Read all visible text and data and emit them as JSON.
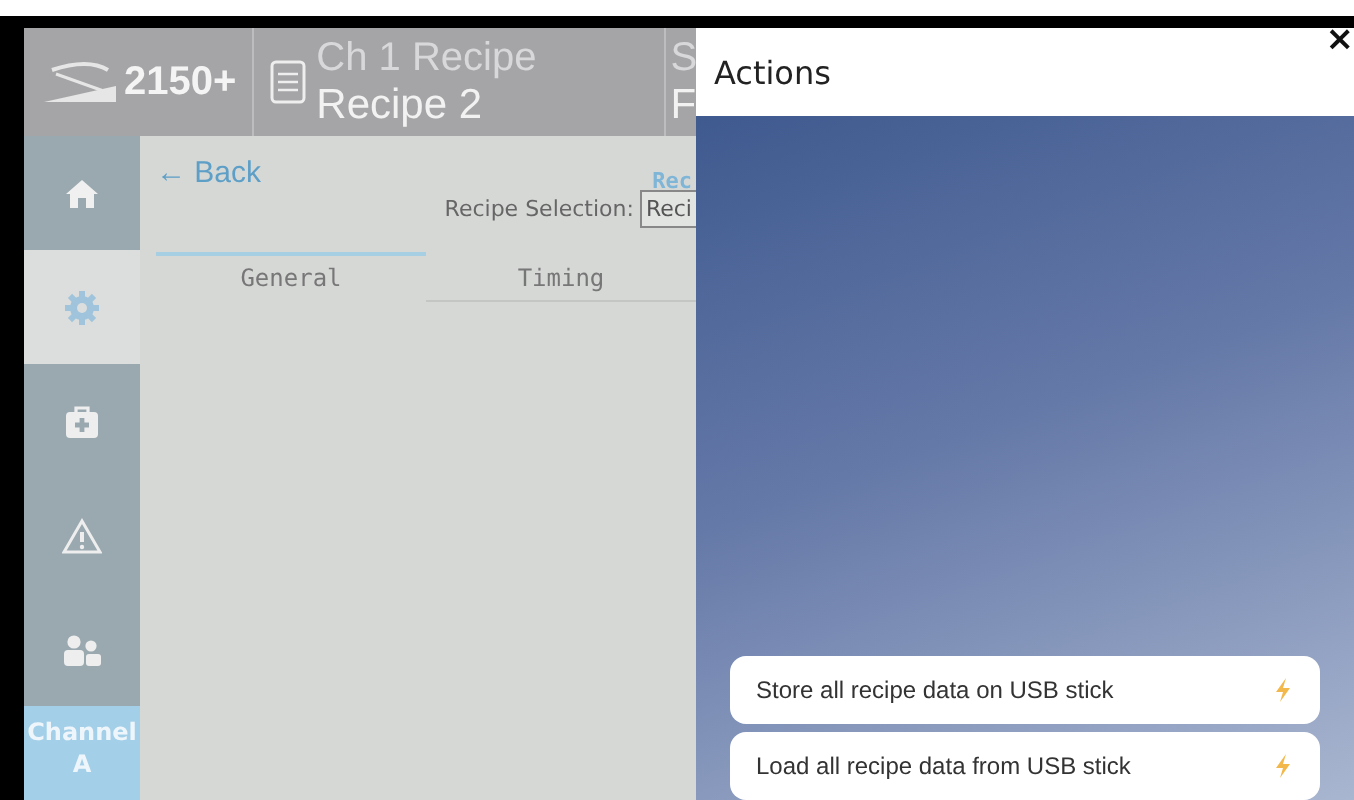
{
  "header": {
    "product": "2150+",
    "recipe_title": "Ch 1 Recipe",
    "recipe_name": "Recipe 2",
    "cut_title": "S",
    "cut_name": "F"
  },
  "sidebar": {
    "items": [
      {
        "kind": "home",
        "selected": false
      },
      {
        "kind": "gear",
        "selected": true
      },
      {
        "kind": "medkit",
        "selected": false
      },
      {
        "kind": "warning",
        "selected": false
      },
      {
        "kind": "users",
        "selected": false
      }
    ],
    "channel": "Channel A"
  },
  "content": {
    "back": "← Back",
    "title": "Rec",
    "selection_label": "Recipe Selection:",
    "selection_value": "Reci",
    "tabs": [
      {
        "label": "General",
        "selected": true
      },
      {
        "label": "Timing",
        "selected": false
      }
    ]
  },
  "actions": {
    "title": "Actions",
    "close": "×",
    "buttons": [
      {
        "label": "Store all recipe data on USB stick"
      },
      {
        "label": "Load all recipe data from USB stick"
      }
    ]
  }
}
